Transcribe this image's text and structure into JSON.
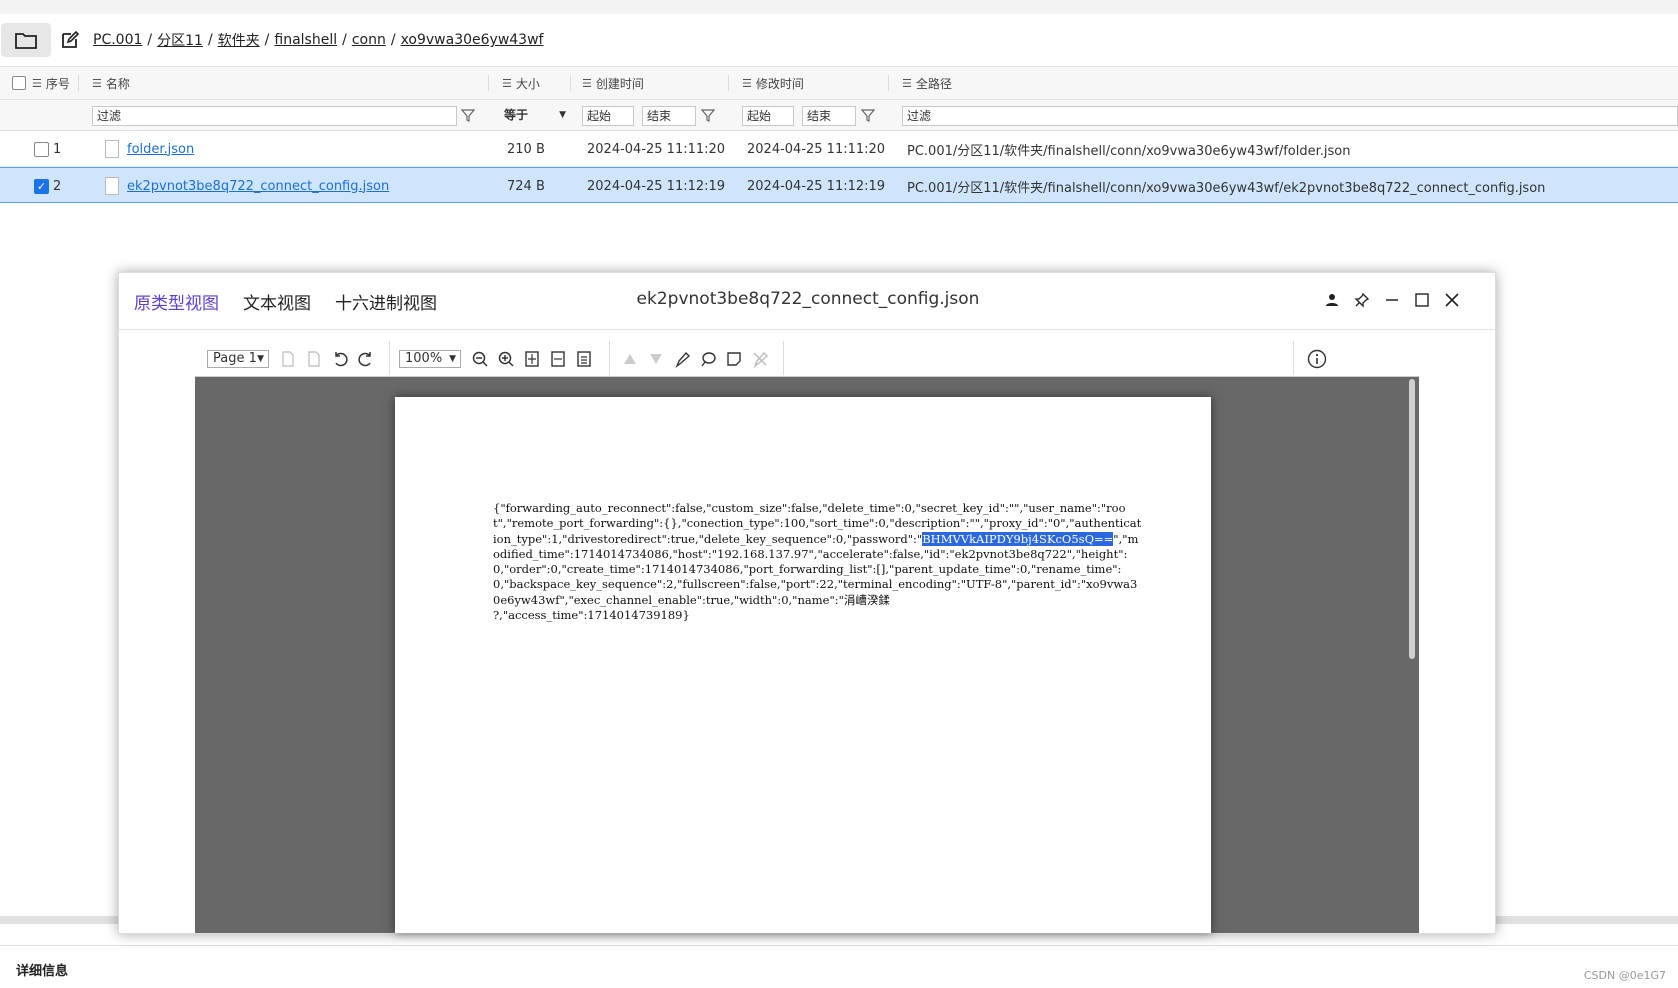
{
  "breadcrumb": [
    "PC.001",
    "分区11",
    "软件夹",
    "finalshell",
    "conn",
    "xo9vwa30e6yw43wf"
  ],
  "columns": {
    "index": "序号",
    "name": "名称",
    "size": "大小",
    "created": "创建时间",
    "modified": "修改时间",
    "path": "全路径"
  },
  "filters": {
    "name": "过滤",
    "size": "等于",
    "start1": "起始",
    "end1": "结束",
    "start2": "起始",
    "end2": "结束",
    "path": "过滤"
  },
  "rows": [
    {
      "index": "1",
      "name": "folder.json",
      "size": "210 B",
      "created": "2024-04-25 11:11:20",
      "modified": "2024-04-25 11:11:20",
      "path": "PC.001/分区11/软件夹/finalshell/conn/xo9vwa30e6yw43wf/folder.json",
      "checked": false
    },
    {
      "index": "2",
      "name": "ek2pvnot3be8q722_connect_config.json",
      "size": "724 B",
      "created": "2024-04-25 11:12:19",
      "modified": "2024-04-25 11:12:19",
      "path": "PC.001/分区11/软件夹/finalshell/conn/xo9vwa30e6yw43wf/ek2pvnot3be8q722_connect_config.json",
      "checked": true
    }
  ],
  "dialog": {
    "tabs": [
      "原类型视图",
      "文本视图",
      "十六进制视图"
    ],
    "title": "ek2pvnot3be8q722_connect_config.json",
    "page_select": "Page 1",
    "zoom_select": "100%",
    "content_before": "{\"forwarding_auto_reconnect\":false,\"custom_size\":false,\"delete_time\":0,\"secret_key_id\":\"\",\"user_name\":\"root\",\"remote_port_forwarding\":{},\"conection_type\":100,\"sort_time\":0,\"description\":\"\",\"proxy_id\":\"0\",\"authentication_type\":1,\"drivestoredirect\":true,\"delete_key_sequence\":0,\"password\":\"",
    "content_highlight": "BHMVVkAIPDY9bj4SKcO5sQ==",
    "content_after": "\",\"modified_time\":1714014734086,\"host\":\"192.168.137.97\",\"accelerate\":false,\"id\":\"ek2pvnot3be8q722\",\"height\":0,\"order\":0,\"create_time\":1714014734086,\"port_forwarding_list\":[],\"parent_update_time\":0,\"rename_time\":0,\"backspace_key_sequence\":2,\"fullscreen\":false,\"port\":22,\"terminal_encoding\":\"UTF-8\",\"parent_id\":\"xo9vwa30e6yw43wf\",\"exec_channel_enable\":true,\"width\":0,\"name\":\"涓嶆湀鍒\n?,\"access_time\":1714014739189}"
  },
  "details_label": "详细信息",
  "watermark": "CSDN @0e1G7",
  "colors": {
    "accent": "#5b3fd8",
    "selected_row": "#cfe5fb",
    "highlight": "#2b68e0",
    "link": "#1a6fd6"
  }
}
